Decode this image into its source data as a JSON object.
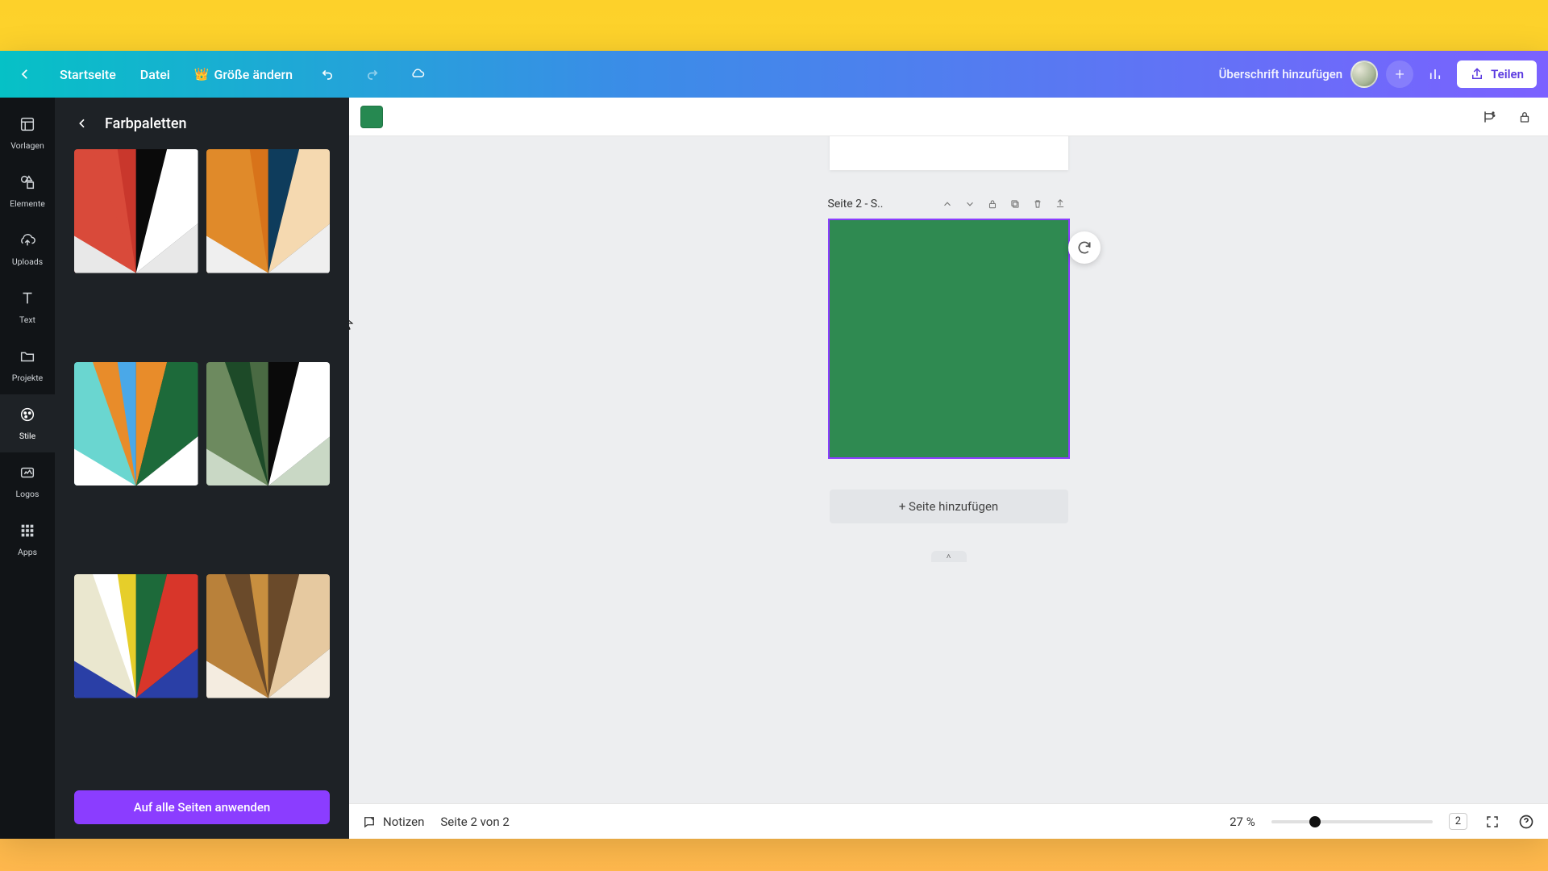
{
  "topbar": {
    "home_label": "Startseite",
    "file_label": "Datei",
    "resize_label": "Größe ändern",
    "title_placeholder": "Überschrift hinzufügen",
    "share_label": "Teilen"
  },
  "toolbar2": {
    "swatch_color": "#268951"
  },
  "rail": [
    {
      "key": "templates",
      "label": "Vorlagen"
    },
    {
      "key": "elements",
      "label": "Elemente"
    },
    {
      "key": "uploads",
      "label": "Uploads"
    },
    {
      "key": "text",
      "label": "Text"
    },
    {
      "key": "projects",
      "label": "Projekte"
    },
    {
      "key": "styles",
      "label": "Stile"
    },
    {
      "key": "logos",
      "label": "Logos"
    },
    {
      "key": "apps",
      "label": "Apps"
    }
  ],
  "rail_active": "styles",
  "side_panel": {
    "title": "Farbpaletten",
    "apply_label": "Auf alle Seiten anwenden",
    "palettes": [
      {
        "colors": [
          "#d94a3a",
          "#c9372c",
          "#0a0a0a",
          "#ffffff",
          "#e8e8e8",
          "#d94a3a"
        ]
      },
      {
        "colors": [
          "#e08a2a",
          "#d8731a",
          "#0e3c5c",
          "#f5d9b0",
          "#efefef",
          "#e08a2a"
        ]
      },
      {
        "colors": [
          "#6ad6d0",
          "#4aa8e8",
          "#e88c2a",
          "#1d6a3a",
          "#ffffff",
          "#e88c2a"
        ]
      },
      {
        "colors": [
          "#6d8a5f",
          "#4a6a43",
          "#0a0a0a",
          "#ffffff",
          "#c9d8c5",
          "#1d4a28"
        ]
      },
      {
        "colors": [
          "#eae7cf",
          "#e6ce2a",
          "#1d6a3a",
          "#d8362a",
          "#2a3fa6",
          "#ffffff"
        ]
      },
      {
        "colors": [
          "#b9813a",
          "#c88f3f",
          "#6a4a2a",
          "#e6c9a0",
          "#f4ece0",
          "#6a4a2a"
        ]
      }
    ]
  },
  "canvas": {
    "page_label": "Seite 2 - S..",
    "page_bg": "#2f8a51",
    "add_page_label": "+ Seite hinzufügen"
  },
  "bottombar": {
    "notes_label": "Notizen",
    "page_counter": "Seite 2 von 2",
    "zoom_label": "27 %",
    "zoom_fraction": 0.27,
    "page_badge": "2"
  }
}
